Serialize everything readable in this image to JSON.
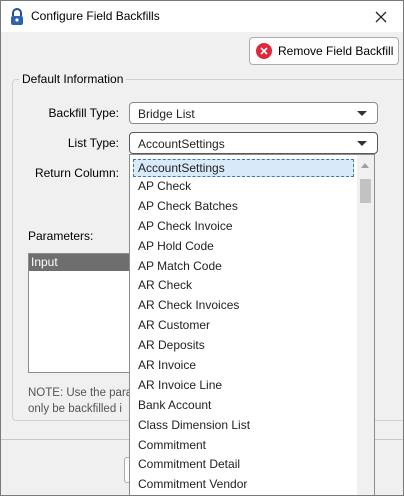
{
  "window": {
    "title": "Configure Field Backfills",
    "icon": "padlock-icon",
    "close_icon": "close-icon"
  },
  "toolbar": {
    "remove_label": "Remove Field Backfill",
    "remove_icon": "remove-circle-icon"
  },
  "group": {
    "title": "Default Information"
  },
  "form": {
    "backfill_type_label": "Backfill Type:",
    "backfill_type_value": "Bridge List",
    "list_type_label": "List Type:",
    "list_type_value": "AccountSettings",
    "return_column_label": "Return Column:",
    "parameters_label": "Parameters:",
    "parameters_header": "Input"
  },
  "note": {
    "line1": "NOTE: Use the para",
    "line2": "only be backfilled i"
  },
  "dropdown": {
    "selected": "AccountSettings",
    "items": [
      "AccountSettings",
      "AP Check",
      "AP Check Batches",
      "AP Check Invoice",
      "AP Hold Code",
      "AP Match Code",
      "AR Check",
      "AR Check Invoices",
      "AR Customer",
      "AR Deposits",
      "AR Invoice",
      "AR Invoice Line",
      "Bank Account",
      "Class Dimension List",
      "Commitment",
      "Commitment Detail",
      "Commitment Vendor"
    ]
  },
  "colors": {
    "remove_icon": "#e0283c",
    "selection_bg": "#d8eaf9",
    "selection_border": "#3a76b6",
    "params_header_bg": "#6e6e6e"
  }
}
